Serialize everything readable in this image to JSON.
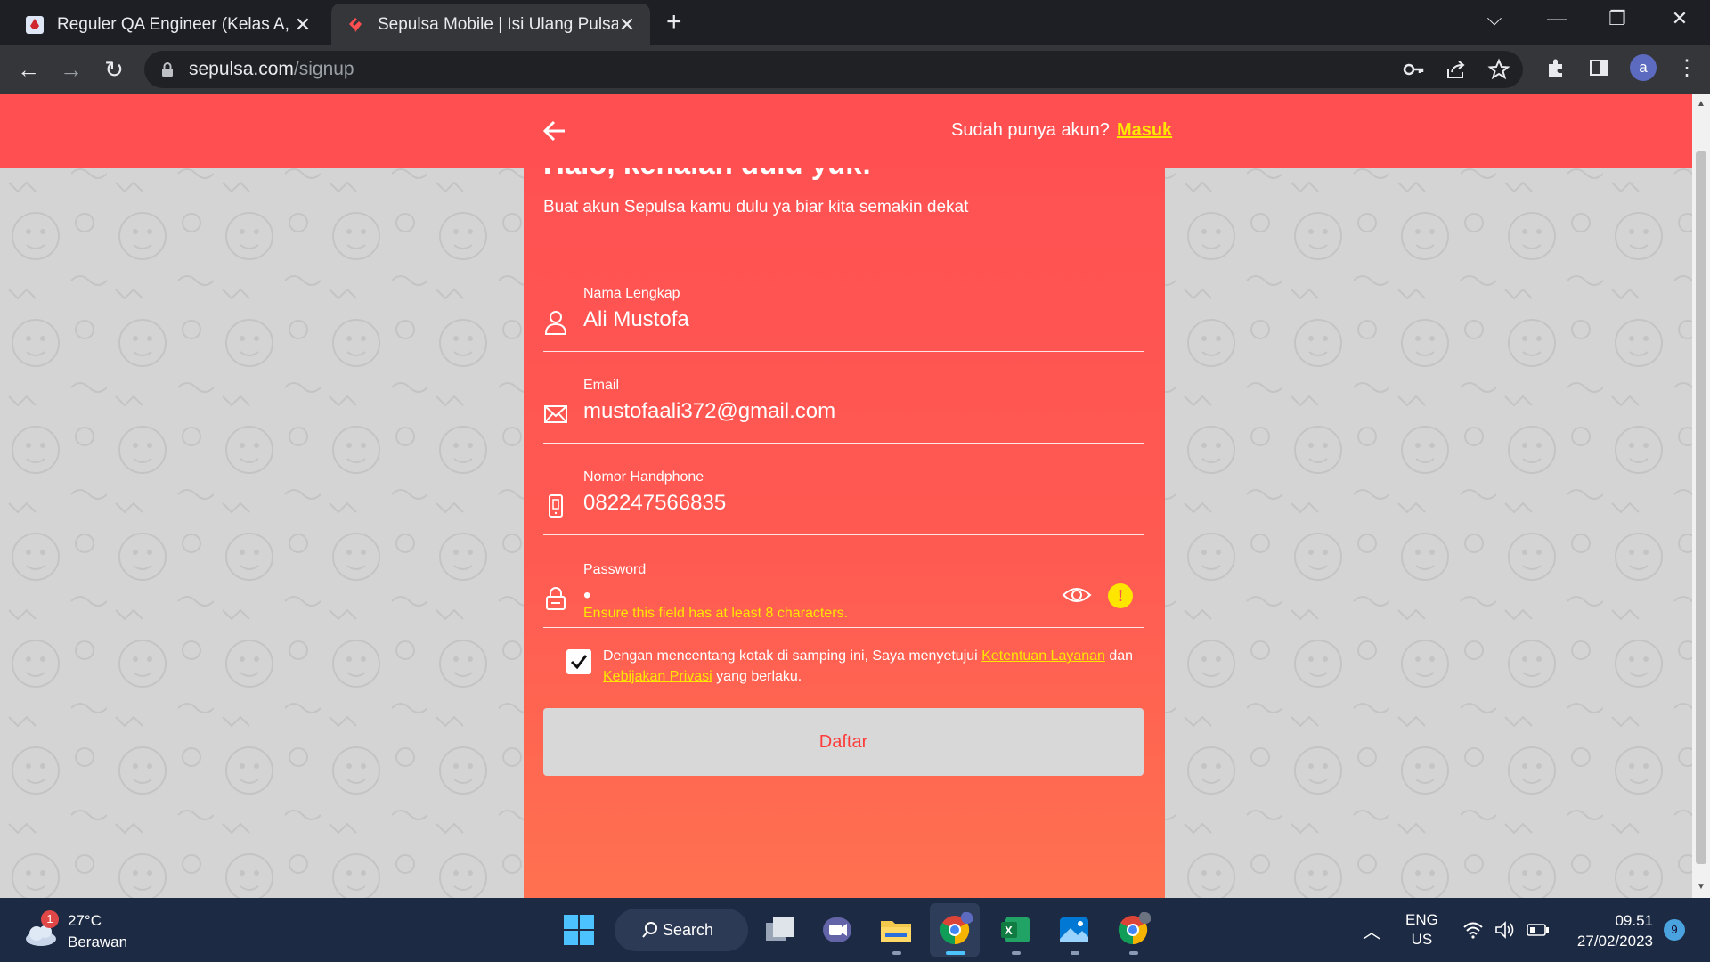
{
  "browser": {
    "tabs": [
      {
        "title": "Reguler QA Engineer (Kelas A, B, C",
        "active": false
      },
      {
        "title": "Sepulsa Mobile | Isi Ulang Pulsa S",
        "active": true
      }
    ],
    "url_host": "sepulsa.com",
    "url_path": "/signup",
    "profile_initial": "a"
  },
  "header": {
    "login_prompt": "Sudah punya akun?",
    "login_link": "Masuk"
  },
  "form": {
    "heading": "Halo, kenalan dulu yuk!",
    "subheading": "Buat akun Sepulsa kamu dulu ya biar kita semakin dekat",
    "fields": [
      {
        "label": "Nama Lengkap",
        "value": "Ali Mustofa",
        "icon": "user-icon"
      },
      {
        "label": "Email",
        "value": "mustofaali372@gmail.com",
        "icon": "mail-icon"
      },
      {
        "label": "Nomor Handphone",
        "value": "082247566835",
        "icon": "phone-icon"
      },
      {
        "label": "Password",
        "value": "•",
        "icon": "lock-icon"
      }
    ],
    "password_error": "Ensure this field has at least 8 characters.",
    "agree_text_1": "Dengan mencentang kotak di samping ini, Saya menyetujui ",
    "agree_link_1": "Ketentuan Layanan",
    "agree_text_2": " dan ",
    "agree_link_2": "Kebijakan Privasi",
    "agree_text_3": " yang berlaku.",
    "agree_checked": true,
    "submit_label": "Daftar"
  },
  "colors": {
    "brand": "#ff4f51",
    "accent_yellow": "#ffe600",
    "button_bg": "#d8d8d8"
  },
  "taskbar": {
    "weather_badge": "1",
    "weather_temp": "27°C",
    "weather_desc": "Berawan",
    "search_label": "Search",
    "lang_1": "ENG",
    "lang_2": "US",
    "time": "09.51",
    "date": "27/02/2023",
    "notification_count": "9"
  }
}
